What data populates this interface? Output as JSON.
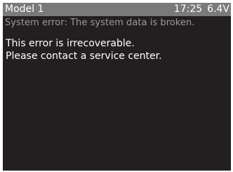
{
  "status_bar": {
    "model": "Model 1",
    "time": "17:25",
    "voltage": "6.4V"
  },
  "error": {
    "title": "System error: The system data is broken.",
    "lines": [
      "This error is irrecoverable.",
      "Please contact a service center."
    ]
  },
  "colors": {
    "screen_background": "#231f20",
    "status_bar_background": "#7a7a7a",
    "error_title_text": "#9a9a9a",
    "message_text": "#ffffff"
  }
}
